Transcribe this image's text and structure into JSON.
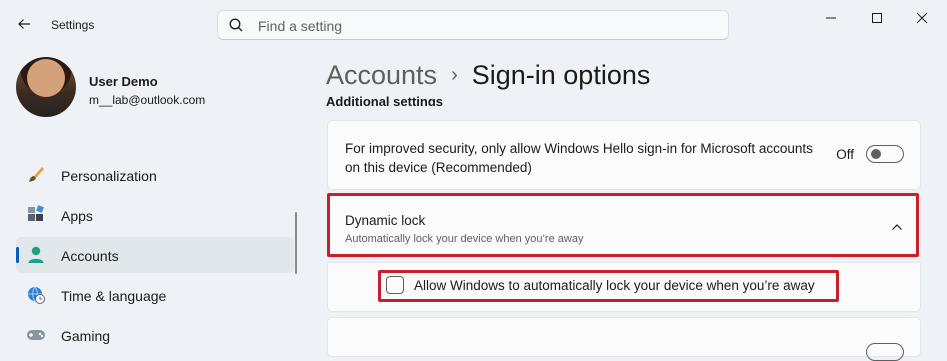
{
  "window": {
    "app_title": "Settings",
    "search_placeholder": "Find a setting"
  },
  "profile": {
    "name": "User Demo",
    "email": "m__lab@outlook.com"
  },
  "nav": {
    "items": [
      {
        "label": "Personalization",
        "icon": "paintbrush-icon"
      },
      {
        "label": "Apps",
        "icon": "apps-icon"
      },
      {
        "label": "Accounts",
        "icon": "person-icon",
        "selected": true
      },
      {
        "label": "Time & language",
        "icon": "globe-clock-icon"
      },
      {
        "label": "Gaming",
        "icon": "gamepad-icon"
      }
    ]
  },
  "breadcrumb": {
    "parent": "Accounts",
    "separator": "›",
    "current": "Sign-in options"
  },
  "section_heading": "Additional settings",
  "settings": {
    "hello_only": {
      "text": "For improved security, only allow Windows Hello sign-in for Microsoft accounts on this device (Recommended)",
      "state_label": "Off"
    },
    "dynamic_lock": {
      "title": "Dynamic lock",
      "subtitle": "Automatically lock your device when you’re away",
      "expanded": true,
      "checkbox_label": "Allow Windows to automatically lock your device when you’re away",
      "checked": false
    }
  },
  "colors": {
    "highlight": "#c8202a",
    "accent": "#005fb8"
  }
}
